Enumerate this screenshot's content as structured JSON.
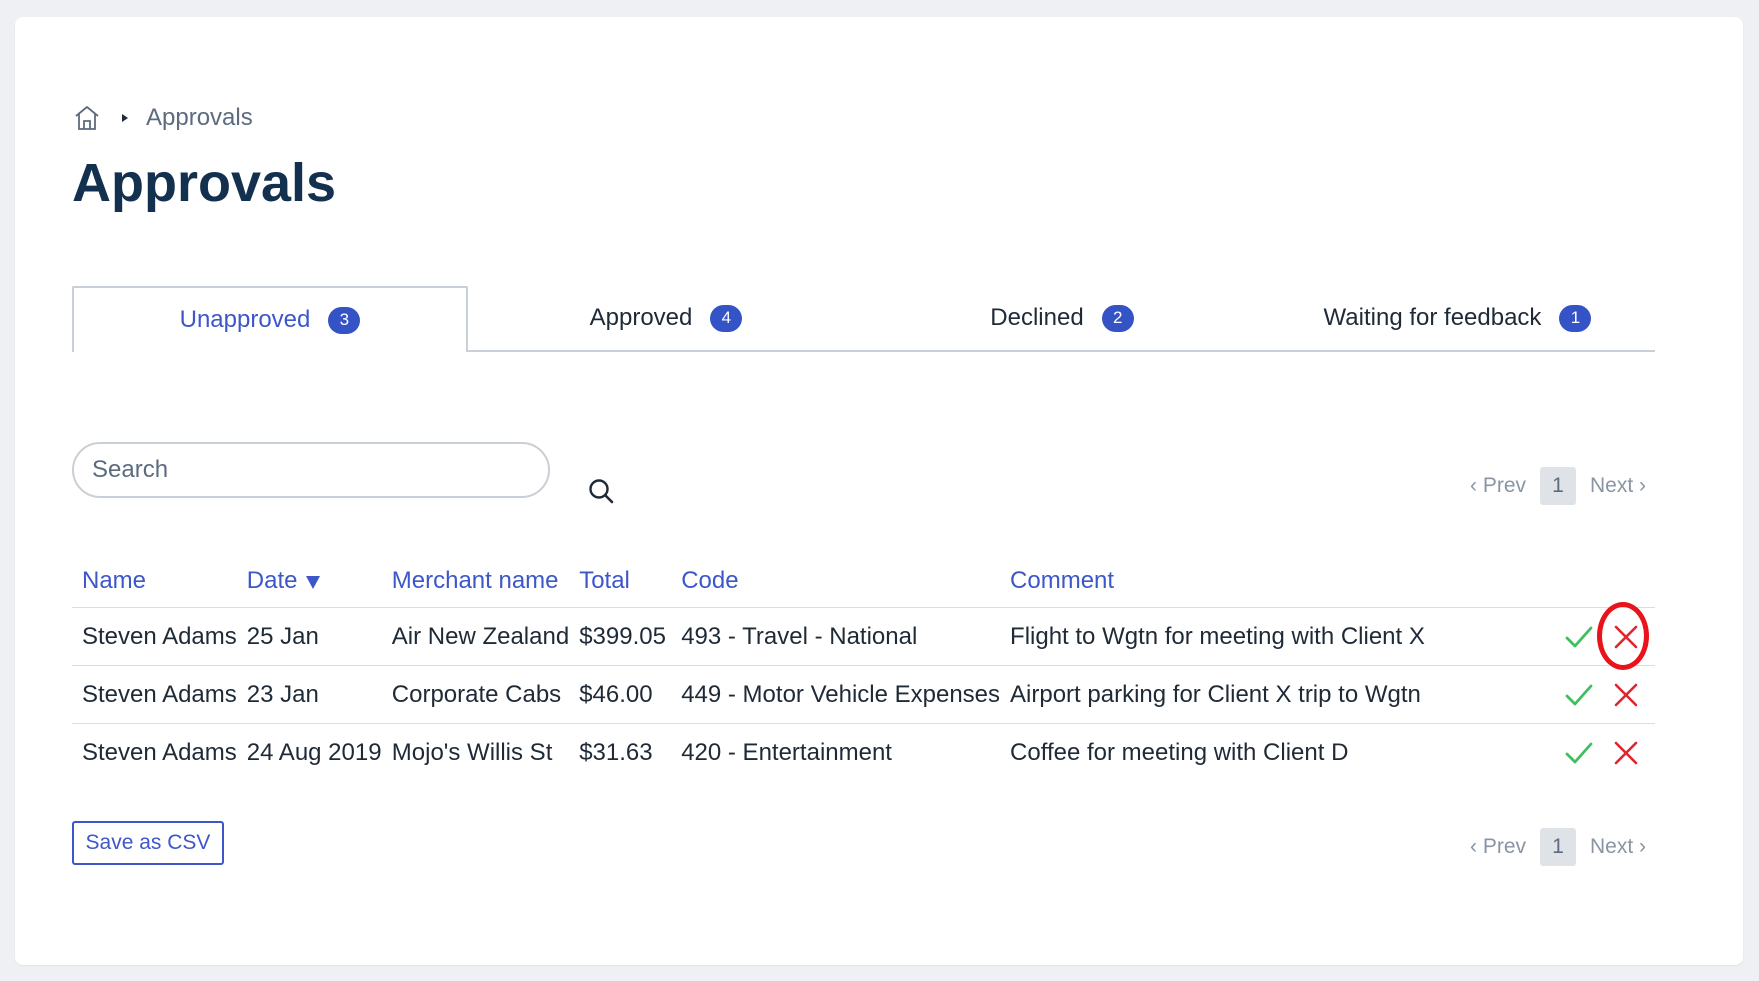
{
  "breadcrumb": {
    "current": "Approvals"
  },
  "page": {
    "title": "Approvals"
  },
  "tabs": [
    {
      "label": "Unapproved",
      "count": "3"
    },
    {
      "label": "Approved",
      "count": "4"
    },
    {
      "label": "Declined",
      "count": "2"
    },
    {
      "label": "Waiting for feedback",
      "count": "1"
    }
  ],
  "search": {
    "placeholder": "Search",
    "value": ""
  },
  "pagination": {
    "prev": "‹ Prev",
    "page": "1",
    "next": "Next ›"
  },
  "table": {
    "headers": [
      "Name",
      "Date",
      "Merchant name",
      "Total",
      "Code",
      "Comment"
    ],
    "sorted_column": "Date",
    "sort_direction": "descending",
    "rows": [
      [
        "Steven Adams",
        "25 Jan",
        "Air New Zealand",
        "$399.05",
        "493 - Travel - National",
        "Flight to Wgtn for meeting with Client X"
      ],
      [
        "Steven Adams",
        "23 Jan",
        "Corporate Cabs",
        "$46.00",
        "449 - Motor Vehicle Expenses",
        "Airport parking for Client X trip to Wgtn"
      ],
      [
        "Steven Adams",
        "24 Aug 2019",
        "Mojo's Willis St",
        "$31.63",
        "420 - Entertainment",
        "Coffee for meeting with Client D"
      ]
    ],
    "row_actions": [
      "approve-check-icon",
      "decline-x-icon"
    ],
    "highlighted_action": "row 1 decline"
  },
  "footer": {
    "csv_label": "Save as CSV"
  },
  "colors": {
    "accent": "#3d57c9",
    "badge": "#3353c7",
    "title": "#14304f",
    "approve": "#3fbf5f",
    "decline": "#e0262f",
    "highlight": "#e8131b"
  }
}
